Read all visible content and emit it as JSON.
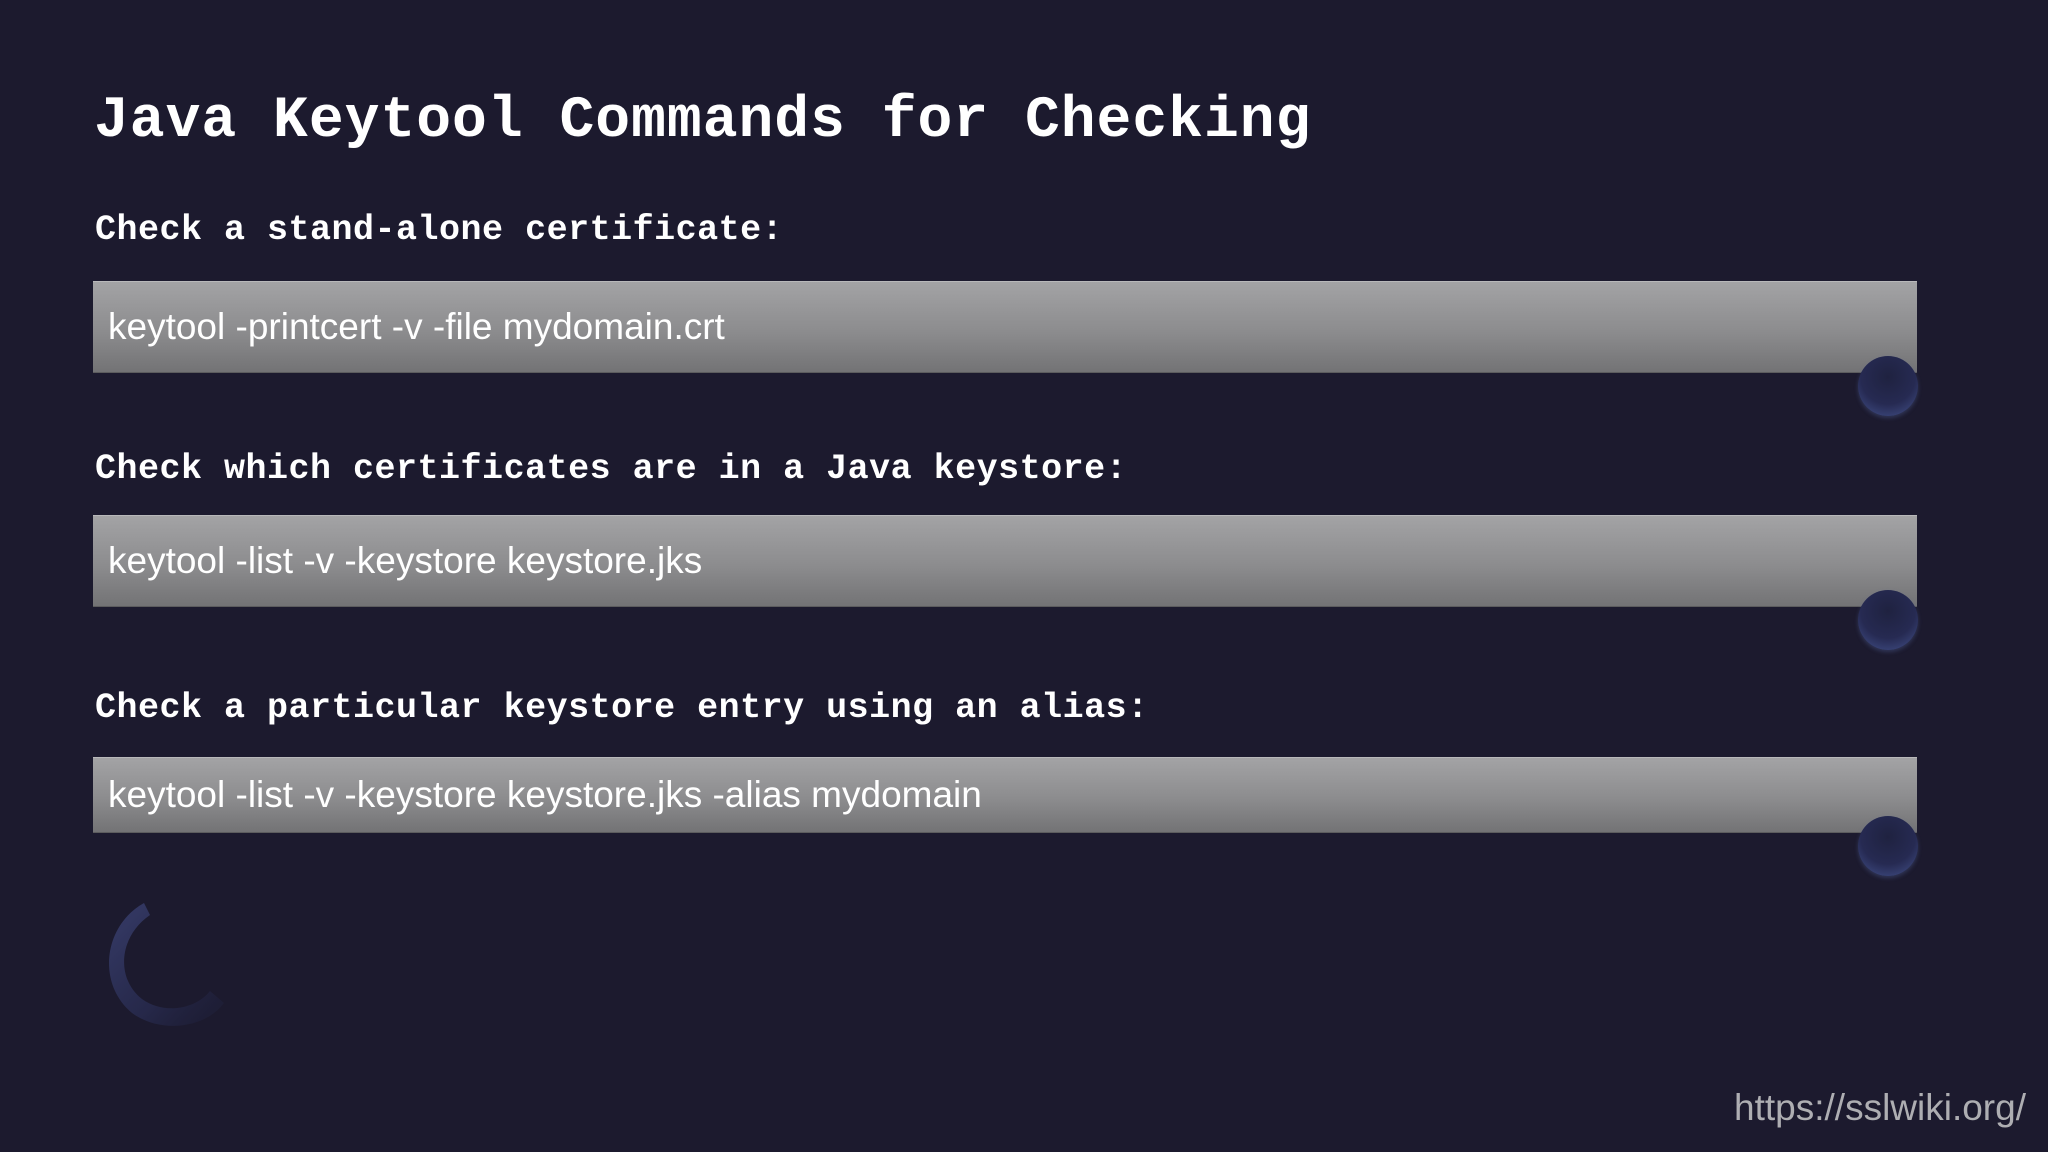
{
  "slide": {
    "title": "Java Keytool Commands for Checking",
    "sections": [
      {
        "label": "Check a stand-alone certificate:",
        "command": "keytool -printcert -v -file mydomain.crt"
      },
      {
        "label": "Check which certificates are in a Java keystore:",
        "command": "keytool -list -v -keystore keystore.jks"
      },
      {
        "label": "Check a particular keystore entry using an alias:",
        "command": "keytool -list -v -keystore keystore.jks -alias mydomain"
      }
    ],
    "watermark_url": "https://sslwiki.org/"
  },
  "colors": {
    "background": "#1c1a2e",
    "command_box": "#8c8c8e",
    "text": "#ffffff",
    "url_text": "#aeaeb2"
  }
}
